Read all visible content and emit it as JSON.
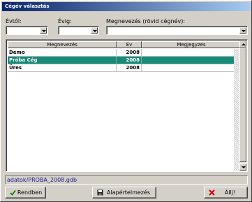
{
  "window": {
    "title": "Cégév választás"
  },
  "filters": {
    "from_label": "Évtől:",
    "from_value": "",
    "to_label": "Évig:",
    "to_value": "",
    "name_label": "Megnevezés (rövid cégnév):",
    "name_value": ""
  },
  "table": {
    "columns": [
      "Megnevezés",
      "Év",
      "Megjegyzés"
    ],
    "rows": [
      {
        "name": "Demo",
        "year": "2008",
        "note": ""
      },
      {
        "name": "Próba Cég",
        "year": "2008",
        "note": ""
      },
      {
        "name": "Üres",
        "year": "2008",
        "note": ""
      }
    ],
    "selected_index": 1
  },
  "status": {
    "path": "adatok/PROBA_2008.gdb"
  },
  "buttons": {
    "ok": "Rendben",
    "default": "Alapértelmezés",
    "cancel": "Állj!"
  },
  "colors": {
    "selection": "#188a78",
    "title_start": "#0a246a",
    "title_end": "#a6caf0"
  }
}
